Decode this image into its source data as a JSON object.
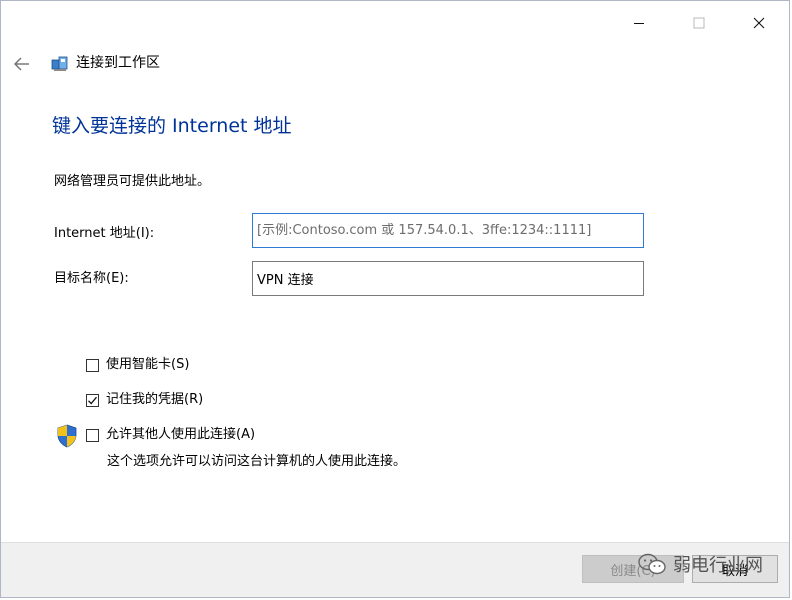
{
  "window": {
    "title": "连接到工作区",
    "controls": [
      "minimize-icon",
      "maximize-icon",
      "close-icon"
    ]
  },
  "nav": {
    "back_icon": "arrow-left-icon",
    "wizard_icon": "workplace-network-icon"
  },
  "main": {
    "heading": "键入要连接的 Internet 地址",
    "description": "网络管理员可提供此地址。",
    "internet_address": {
      "label": "Internet 地址(I):",
      "value": "",
      "placeholder": "[示例:Contoso.com 或 157.54.0.1、3ffe:1234::1111]"
    },
    "destination_name": {
      "label": "目标名称(E):",
      "value": "VPN 连接"
    },
    "options": [
      {
        "label": "使用智能卡(S)",
        "checked": false
      },
      {
        "label": "记住我的凭据(R)",
        "checked": true
      },
      {
        "label": "允许其他人使用此连接(A)",
        "checked": false
      }
    ],
    "allow_note": "这个选项允许可以访问这台计算机的人使用此连接。",
    "shield_icon": "uac-shield-icon"
  },
  "footer": {
    "create_label": "创建(C)",
    "cancel_label": "取消"
  },
  "watermark": {
    "text": "弱电行业网",
    "icon": "wechat-icon"
  },
  "colors": {
    "heading": "#003399",
    "focus_border": "#2f7bd6",
    "footer_bg": "#f0f0f0",
    "shield_blue": "#2f6fd0",
    "shield_yellow": "#f2c21b"
  }
}
